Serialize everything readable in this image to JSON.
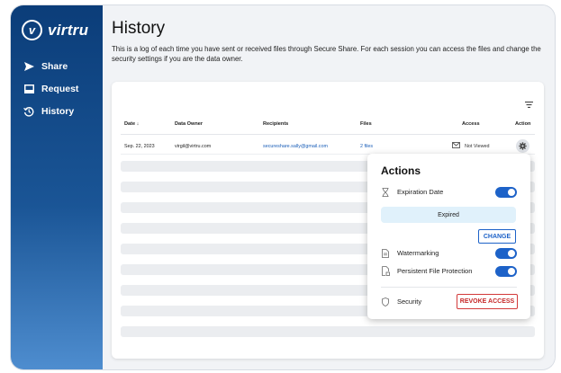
{
  "brand": {
    "logo_mark": "v",
    "name": "virtru"
  },
  "sidebar": {
    "items": [
      {
        "label": "Share",
        "icon": "send-arrow-icon"
      },
      {
        "label": "Request",
        "icon": "inbox-icon"
      },
      {
        "label": "History",
        "icon": "history-icon"
      }
    ]
  },
  "page": {
    "title": "History",
    "description": "This is a log of each time you have sent or received files through Secure Share. For each session you can access the files and change the security settings if you are the data owner."
  },
  "table": {
    "columns": [
      "Date ↓",
      "Data Owner",
      "Recipients",
      "Files",
      "Access",
      "Action"
    ],
    "rows": [
      {
        "date": "Sep. 22, 2023",
        "owner": "virgil@virtru.com",
        "recipients": "secureshare.sally@gmail.com",
        "files": "2 files",
        "access": "Not Viewed"
      }
    ]
  },
  "actions_popover": {
    "title": "Actions",
    "expiration_label": "Expiration Date",
    "expiration_enabled": true,
    "expired_status": "Expired",
    "change_label": "CHANGE",
    "watermarking_label": "Watermarking",
    "watermarking_enabled": true,
    "pfp_label": "Persistent File Protection",
    "pfp_enabled": true,
    "security_label": "Security",
    "revoke_label": "REVOKE ACCESS"
  },
  "colors": {
    "sidebar_top": "#0b3d79",
    "sidebar_bottom": "#4e8dcf",
    "accent": "#1d62c8",
    "danger": "#c62828",
    "link": "#1a5eb8"
  }
}
